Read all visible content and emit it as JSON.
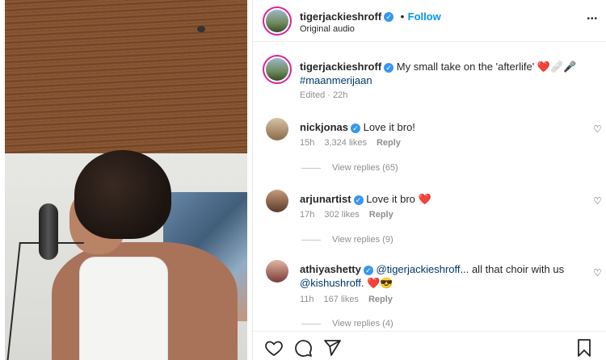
{
  "post": {
    "author": "tigerjackieshroff",
    "follow_label": "Follow",
    "separator": "•",
    "audio": "Original audio"
  },
  "caption": {
    "author": "tigerjackieshroff",
    "text": "My small take on the 'afterlife'",
    "emoji": "❤️🩹🎤",
    "hashtag": "#maanmerijaan",
    "edited": "Edited · 22h"
  },
  "comments": [
    {
      "user": "nickjonas",
      "text": "Love it bro!",
      "time": "15h",
      "likes": "3,324 likes",
      "reply": "Reply",
      "view_replies": "View replies (65)"
    },
    {
      "user": "arjunartist",
      "text": "Love it bro",
      "emoji": "❤️",
      "time": "17h",
      "likes": "302 likes",
      "reply": "Reply",
      "view_replies": "View replies (9)"
    },
    {
      "user": "athiyashetty",
      "mention1": "@tigerjackieshroff",
      "text": "... all that choir with us",
      "mention2": "@kishushroff",
      "text2": ".",
      "emoji": "❤️😎",
      "time": "11h",
      "likes": "167 likes",
      "reply": "Reply",
      "view_replies": "View replies (4)"
    }
  ],
  "icons": {
    "verified": "✓",
    "heart": "♡",
    "more": "•••"
  },
  "colors": {
    "link": "#0095f6",
    "verified": "#3897f0",
    "heart_red": "#ed4956",
    "hashtag": "#00376b"
  }
}
